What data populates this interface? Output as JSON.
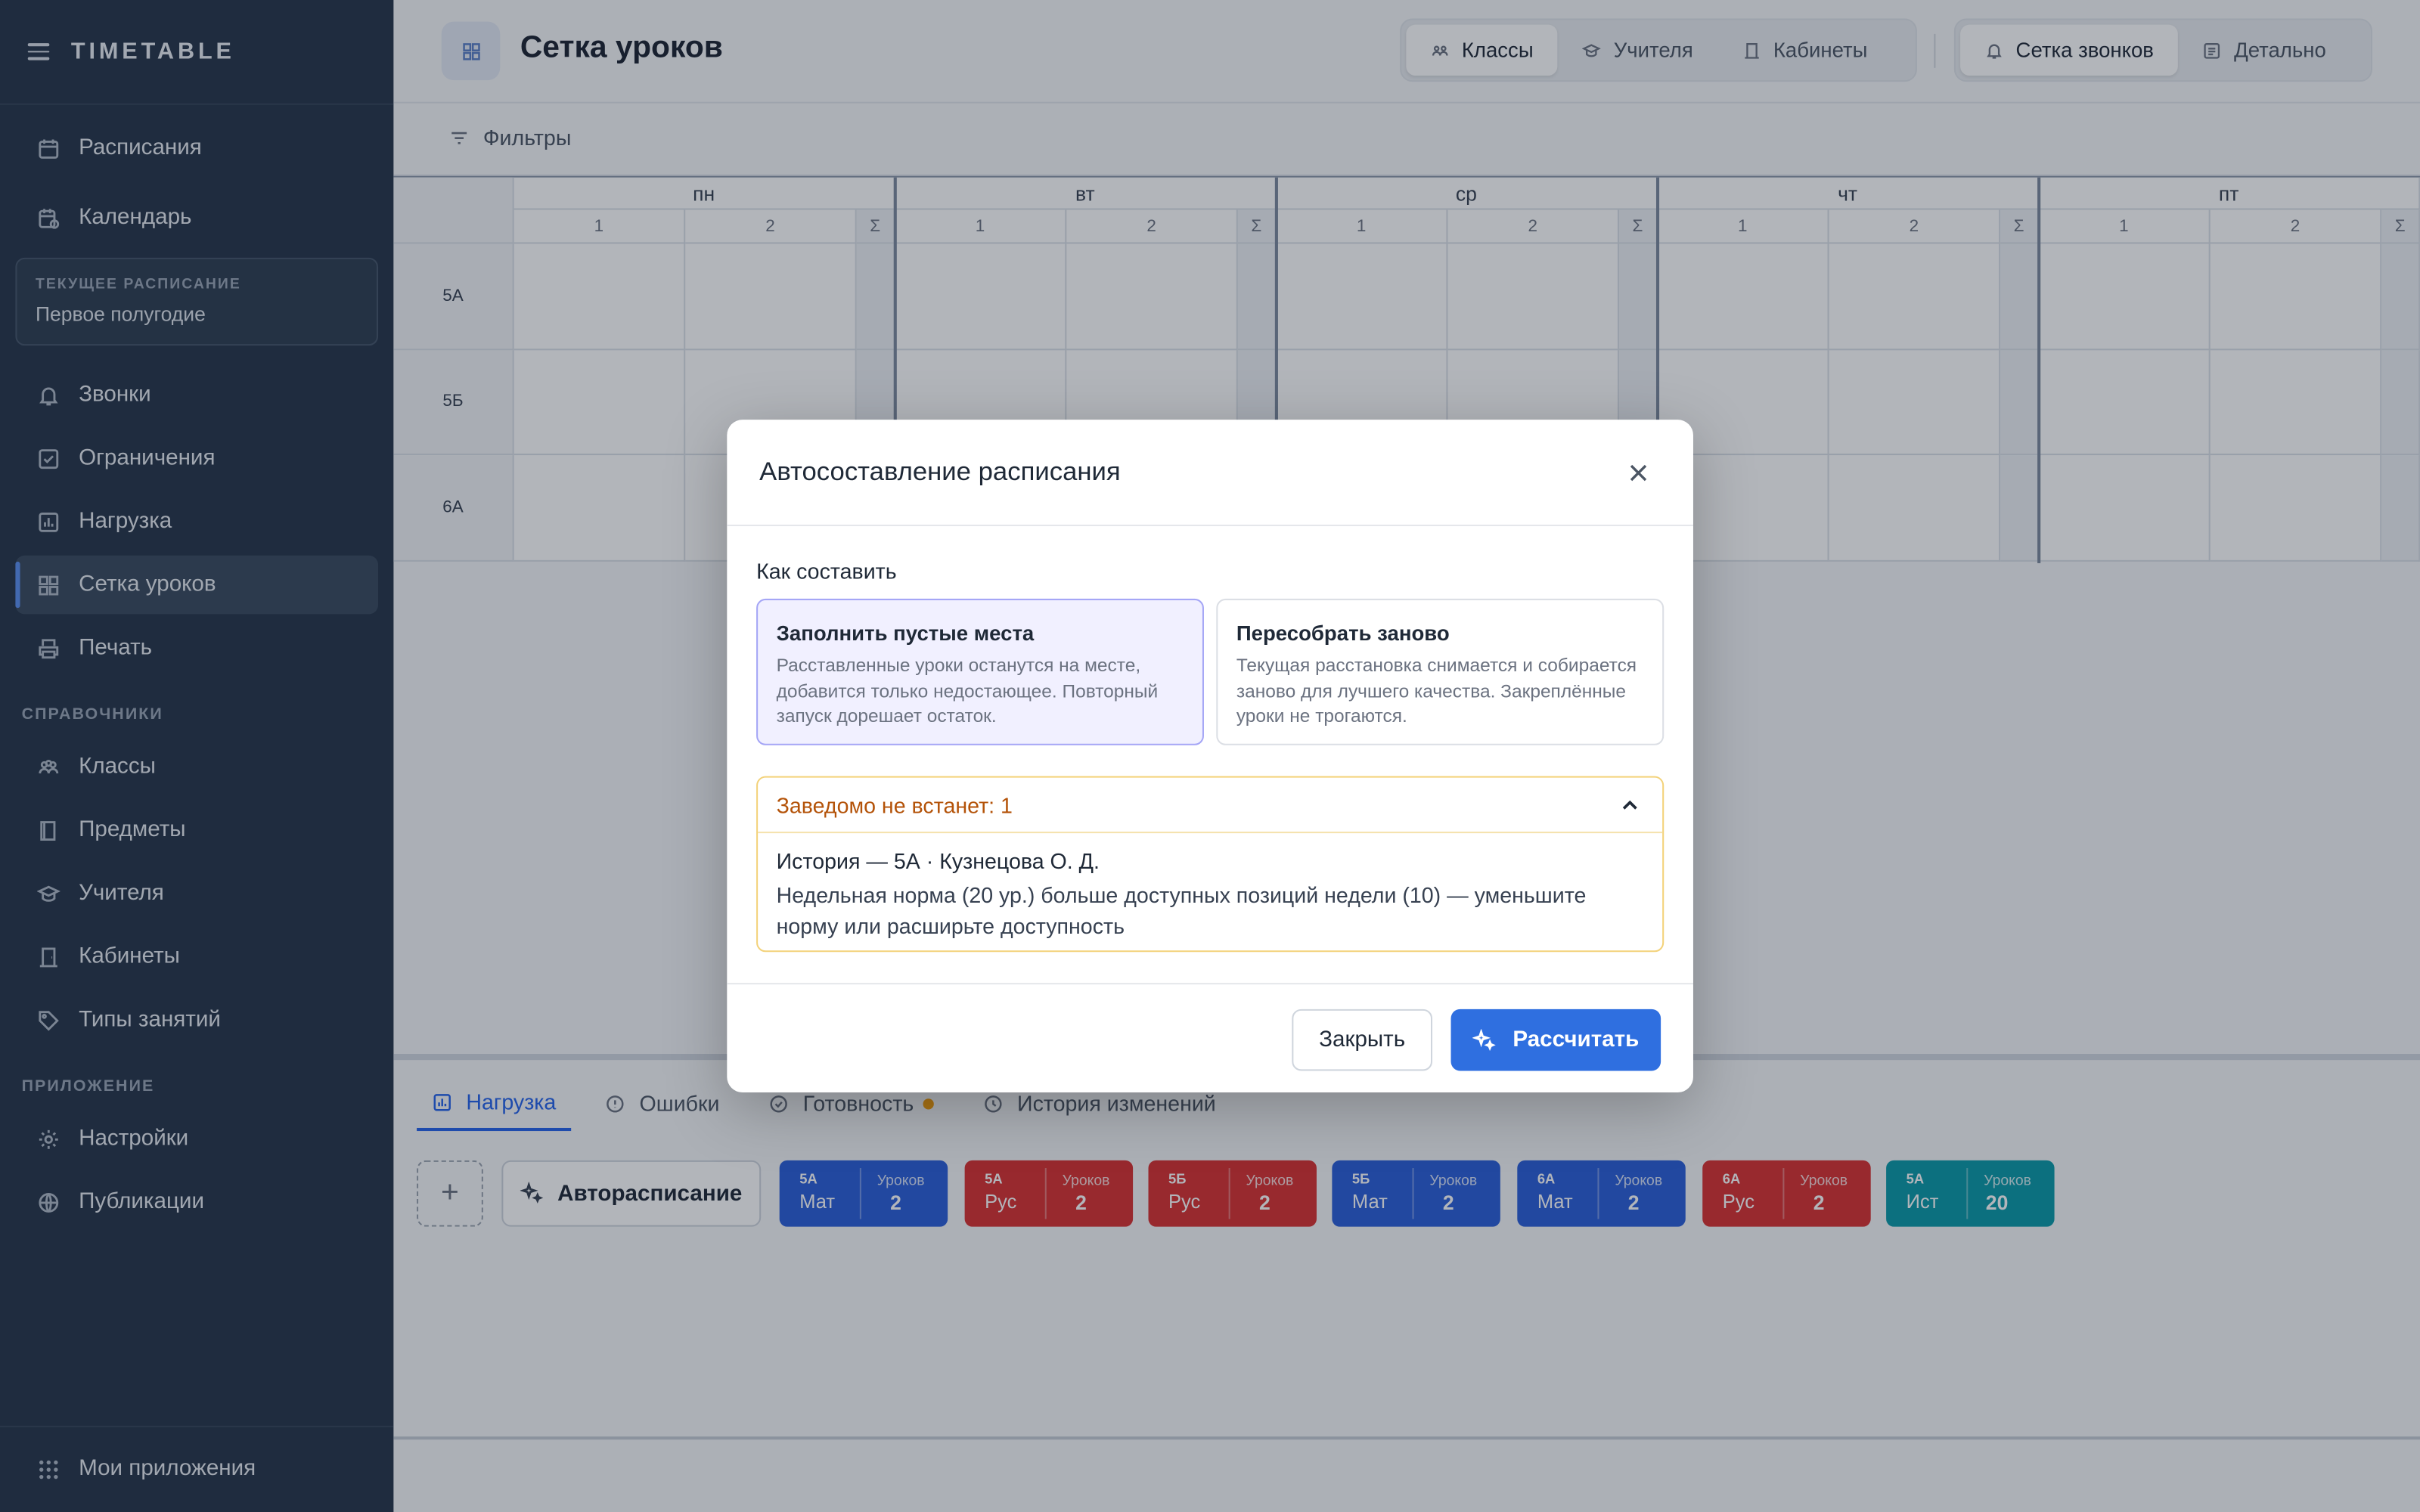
{
  "app": {
    "brand": "TIMETABLE"
  },
  "sidebar": {
    "items_top": [
      {
        "label": "Расписания",
        "icon": "calendar-icon"
      },
      {
        "label": "Календарь",
        "icon": "calendar-clock-icon"
      }
    ],
    "current_schedule": {
      "label": "ТЕКУЩЕЕ РАСПИСАНИЕ",
      "value": "Первое полугодие"
    },
    "items_mid": [
      {
        "label": "Звонки",
        "icon": "bell-icon"
      },
      {
        "label": "Ограничения",
        "icon": "checklist-icon"
      },
      {
        "label": "Нагрузка",
        "icon": "bar-chart-icon"
      },
      {
        "label": "Сетка уроков",
        "icon": "grid-icon"
      },
      {
        "label": "Печать",
        "icon": "printer-icon"
      }
    ],
    "section_refs": "СПРАВОЧНИКИ",
    "items_refs": [
      {
        "label": "Классы",
        "icon": "users-icon"
      },
      {
        "label": "Предметы",
        "icon": "book-icon"
      },
      {
        "label": "Учителя",
        "icon": "graduation-cap-icon"
      },
      {
        "label": "Кабинеты",
        "icon": "door-icon"
      },
      {
        "label": "Типы занятий",
        "icon": "tag-icon"
      }
    ],
    "section_app": "ПРИЛОЖЕНИЕ",
    "items_app": [
      {
        "label": "Настройки",
        "icon": "gear-icon"
      },
      {
        "label": "Публикации",
        "icon": "globe-icon"
      }
    ],
    "footer": {
      "label": "Мои приложения",
      "icon": "apps-grid-icon"
    }
  },
  "header": {
    "title": "Сетка уроков",
    "views": [
      "Классы",
      "Учителя",
      "Кабинеты"
    ],
    "modes": [
      "Сетка звонков",
      "Детально"
    ],
    "filters": "Фильтры"
  },
  "grid": {
    "days": [
      "пн",
      "вт",
      "ср",
      "чт",
      "пт"
    ],
    "periods": [
      "1",
      "2",
      "Σ"
    ],
    "rows": [
      "5А",
      "5Б",
      "6А"
    ]
  },
  "bottom": {
    "tabs": [
      "Нагрузка",
      "Ошибки",
      "Готовность",
      "История изменений"
    ],
    "add": "+",
    "auto": "Авторасписание",
    "chip_label": "Уроков",
    "chips": [
      {
        "cls": "5А",
        "subj": "Мат",
        "count": "2",
        "color": "#2b5fd9"
      },
      {
        "cls": "5А",
        "subj": "Рус",
        "count": "2",
        "color": "#d93232"
      },
      {
        "cls": "5Б",
        "subj": "Рус",
        "count": "2",
        "color": "#d93232"
      },
      {
        "cls": "5Б",
        "subj": "Мат",
        "count": "2",
        "color": "#2b5fd9"
      },
      {
        "cls": "6А",
        "subj": "Мат",
        "count": "2",
        "color": "#2b5fd9"
      },
      {
        "cls": "6А",
        "subj": "Рус",
        "count": "2",
        "color": "#d93232"
      },
      {
        "cls": "5А",
        "subj": "Ист",
        "count": "20",
        "color": "#0b9aa8"
      }
    ]
  },
  "modal": {
    "title": "Автосоставление расписания",
    "how_label": "Как составить",
    "options": [
      {
        "title": "Заполнить пустые места",
        "desc": "Расставленные уроки останутся на месте, добавится только недостающее. Повторный запуск дорешает остаток."
      },
      {
        "title": "Пересобрать заново",
        "desc": "Текущая расстановка снимается и собирается заново для лучшего качества. Закреплённые уроки не трогаются."
      }
    ],
    "warning": {
      "header": "Заведомо не встанет: 1",
      "item_title": "История — 5А · Кузнецова О. Д.",
      "item_desc": "Недельная норма (20 ур.) больше доступных позиций недели (10) — уменьшите норму или расширьте доступность"
    },
    "close_label": "Закрыть",
    "calc_label": "Рассчитать"
  }
}
